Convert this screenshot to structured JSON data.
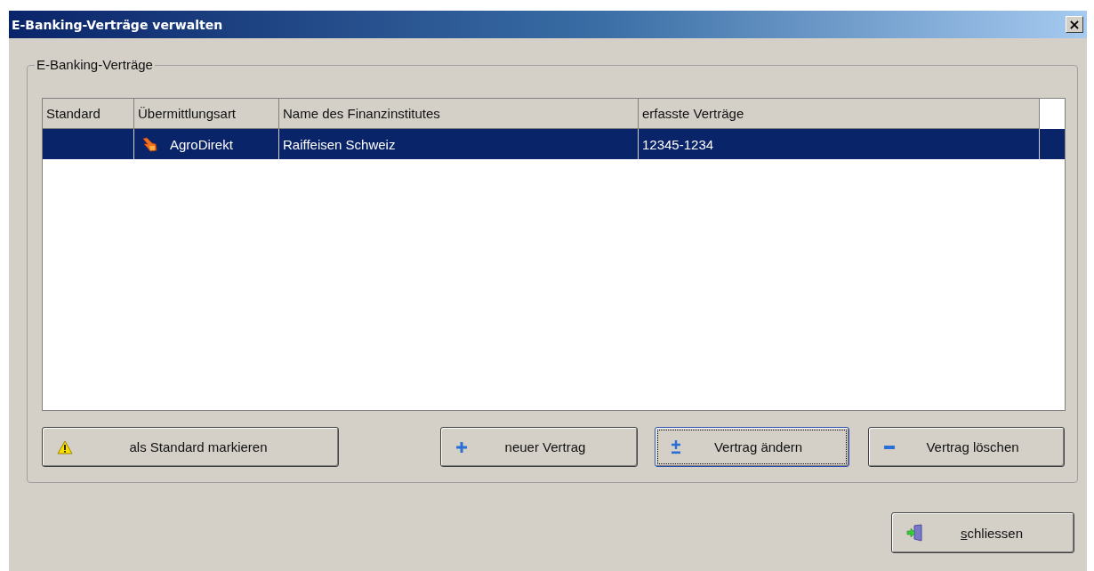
{
  "window": {
    "title": "E-Banking-Verträge verwalten",
    "close_glyph": "×"
  },
  "group": {
    "legend": "E-Banking-Verträge"
  },
  "table": {
    "columns": [
      "Standard",
      "Übermittlungsart",
      "Name des Finanzinstitutes",
      "erfasste Verträge"
    ],
    "rows": [
      {
        "selected": true,
        "cells": [
          "",
          "AgroDirekt",
          "Raiffeisen Schweiz",
          "12345-1234"
        ]
      }
    ]
  },
  "buttons": [
    {
      "label": "als Standard markieren",
      "kind": "warning",
      "focused": false
    },
    {
      "label": "neuer Vertrag",
      "kind": "plus",
      "focused": false
    },
    {
      "label": "Vertrag ändern",
      "kind": "plusminus",
      "focused": true
    },
    {
      "label": "Vertrag löschen",
      "kind": "minus",
      "focused": false
    }
  ],
  "close_button": {
    "label": "schliessen",
    "kind": "exit",
    "first_letter_underlined": true,
    "focused": false
  }
}
